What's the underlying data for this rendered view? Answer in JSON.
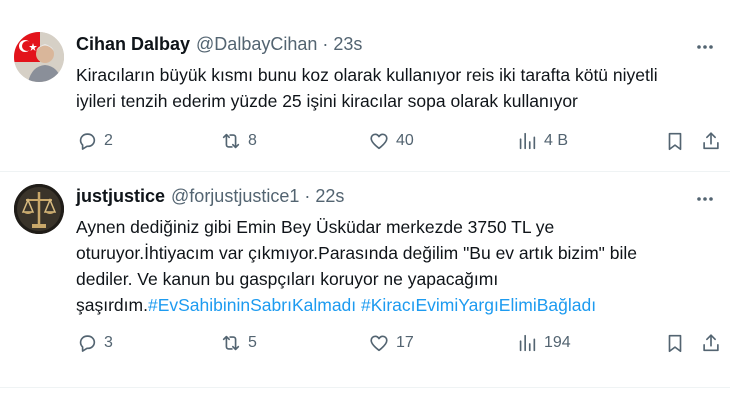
{
  "tweets": [
    {
      "name": "Cihan Dalbay",
      "handle": "@DalbayCihan",
      "separator": "·",
      "time": "23s",
      "lines": [
        "Kiracıların büyük kısmı bunu koz olarak kullanıyor reis iki tarafta kötü niyetli",
        "iyileri tenzih ederim yüzde 25 işini kiracılar sopa olarak kullanıyor"
      ],
      "replies": "2",
      "retweets": "8",
      "likes": "40",
      "views": "4 B",
      "avatar_icon": "profile-photo-with-flag"
    },
    {
      "name": "justjustice",
      "handle": "@forjustjustice1",
      "separator": "·",
      "time": "22s",
      "lines": [
        "Aynen dediğiniz gibi Emin Bey Üsküdar merkezde 3750 TL ye",
        "oturuyor.İhtiyacım var çıkmıyor.Parasında değilim \"Bu ev artık bizim\" bile",
        "dediler. Ve kanun bu gaspçıları koruyor ne yapacağımı"
      ],
      "last_line_prefix": "şaşırdım.",
      "hashtags": [
        "#EvSahibininSabrıKalmadı",
        "#KiracıEvimiYargıElimiBağladı"
      ],
      "replies": "3",
      "retweets": "5",
      "likes": "17",
      "views": "194",
      "avatar_icon": "justice-scales-photo"
    }
  ],
  "icons": {
    "more": "more-horizontal-icon",
    "reply": "reply-icon",
    "retweet": "retweet-icon",
    "like": "heart-icon",
    "views": "views-icon",
    "bookmark": "bookmark-icon",
    "share": "share-icon"
  },
  "colors": {
    "text": "#0f1419",
    "secondary": "#536471",
    "link": "#1d9bf0",
    "divider": "#eff3f4"
  }
}
